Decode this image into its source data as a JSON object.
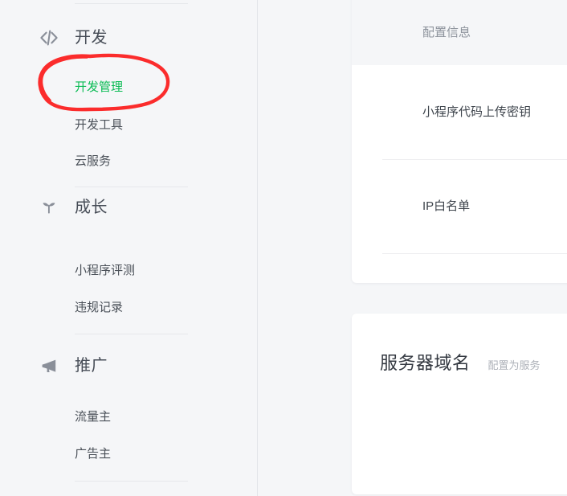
{
  "sidebar": {
    "groups": [
      {
        "id": "dev",
        "icon": "code-icon",
        "title": "开发",
        "items": [
          {
            "label": "开发管理",
            "active": true
          },
          {
            "label": "开发工具",
            "active": false
          },
          {
            "label": "云服务",
            "active": false
          }
        ]
      },
      {
        "id": "growth",
        "icon": "sprout-icon",
        "title": "成长",
        "items": [
          {
            "label": "小程序评测",
            "active": false
          },
          {
            "label": "违规记录",
            "active": false
          }
        ]
      },
      {
        "id": "promotion",
        "icon": "megaphone-icon",
        "title": "推广",
        "items": [
          {
            "label": "流量主",
            "active": false
          },
          {
            "label": "广告主",
            "active": false
          }
        ]
      }
    ]
  },
  "content": {
    "config_card": {
      "rows": [
        {
          "label": "配置信息",
          "selected": true
        },
        {
          "label": "小程序代码上传密钥",
          "selected": false
        },
        {
          "label": "IP白名单",
          "selected": false
        }
      ]
    },
    "domain_card": {
      "title": "服务器域名",
      "description": "配置为服务"
    }
  },
  "annotation": {
    "type": "hand-drawn-ellipse",
    "color": "#fb2c2c",
    "target": "开发管理"
  },
  "colors": {
    "accent_green": "#09bb53",
    "annotation_red": "#fb2c2c",
    "page_background": "#f5f6f8",
    "card_background": "#ffffff",
    "text_primary": "#3e444c",
    "text_muted": "#8d939c"
  }
}
